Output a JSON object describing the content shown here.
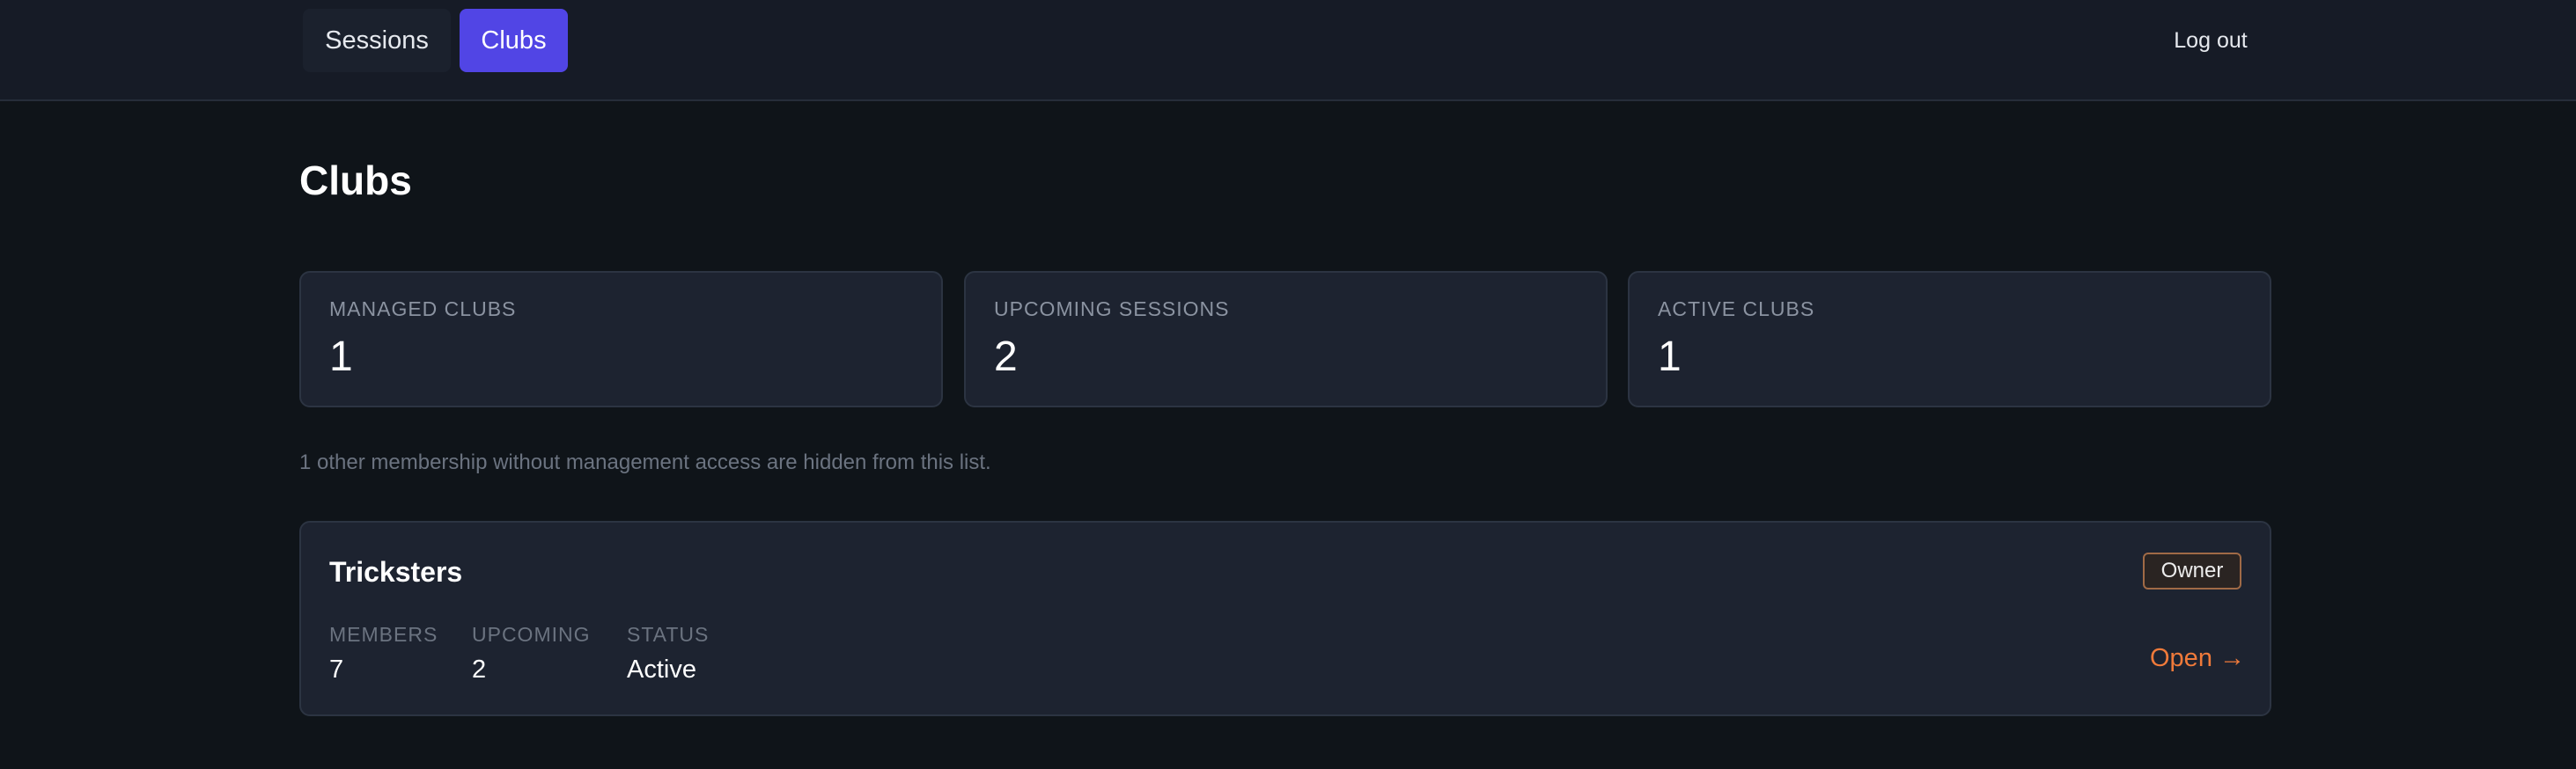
{
  "nav": {
    "tabs": [
      {
        "label": "Sessions",
        "active": false
      },
      {
        "label": "Clubs",
        "active": true
      }
    ],
    "logout_label": "Log out"
  },
  "page": {
    "title": "Clubs"
  },
  "stats": [
    {
      "label": "MANAGED CLUBS",
      "value": "1"
    },
    {
      "label": "UPCOMING SESSIONS",
      "value": "2"
    },
    {
      "label": "ACTIVE CLUBS",
      "value": "1"
    }
  ],
  "hidden_note": "1 other membership without management access are hidden from this list.",
  "clubs": [
    {
      "name": "Tricksters",
      "role": "Owner",
      "members_label": "MEMBERS",
      "members": "7",
      "upcoming_label": "UPCOMING",
      "upcoming": "2",
      "status_label": "STATUS",
      "status": "Active",
      "open_label": "Open →"
    }
  ],
  "colors": {
    "accent": "#5145e5",
    "link": "#f07a3a",
    "background": "#0f1419",
    "card": "#1d2330"
  }
}
